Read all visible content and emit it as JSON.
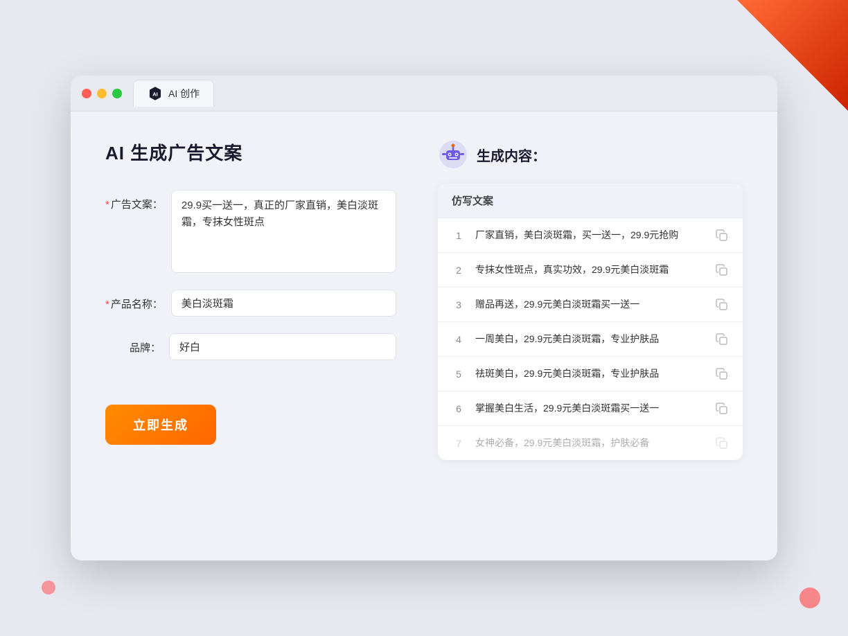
{
  "window": {
    "tab_label": "AI 创作"
  },
  "page": {
    "title": "AI 生成广告文案"
  },
  "form": {
    "ad_copy_label": "广告文案：",
    "ad_copy_required": "*",
    "ad_copy_value": "29.9买一送一，真正的厂家直销，美白淡斑霜，专抹女性斑点",
    "product_name_label": "产品名称：",
    "product_name_required": "*",
    "product_name_value": "美白淡斑霜",
    "brand_label": "品牌：",
    "brand_value": "好白",
    "generate_button": "立即生成"
  },
  "result": {
    "header_label": "生成内容：",
    "table_header": "仿写文案",
    "rows": [
      {
        "number": "1",
        "text": "厂家直销，美白淡斑霜，买一送一，29.9元抢购",
        "dimmed": false
      },
      {
        "number": "2",
        "text": "专抹女性斑点，真实功效，29.9元美白淡斑霜",
        "dimmed": false
      },
      {
        "number": "3",
        "text": "赠品再送，29.9元美白淡斑霜买一送一",
        "dimmed": false
      },
      {
        "number": "4",
        "text": "一周美白，29.9元美白淡斑霜，专业护肤品",
        "dimmed": false
      },
      {
        "number": "5",
        "text": "祛斑美白，29.9元美白淡斑霜，专业护肤品",
        "dimmed": false
      },
      {
        "number": "6",
        "text": "掌握美白生活，29.9元美白淡斑霜买一送一",
        "dimmed": false
      },
      {
        "number": "7",
        "text": "女神必备，29.9元美白淡斑霜，护肤必备",
        "dimmed": true
      }
    ]
  }
}
